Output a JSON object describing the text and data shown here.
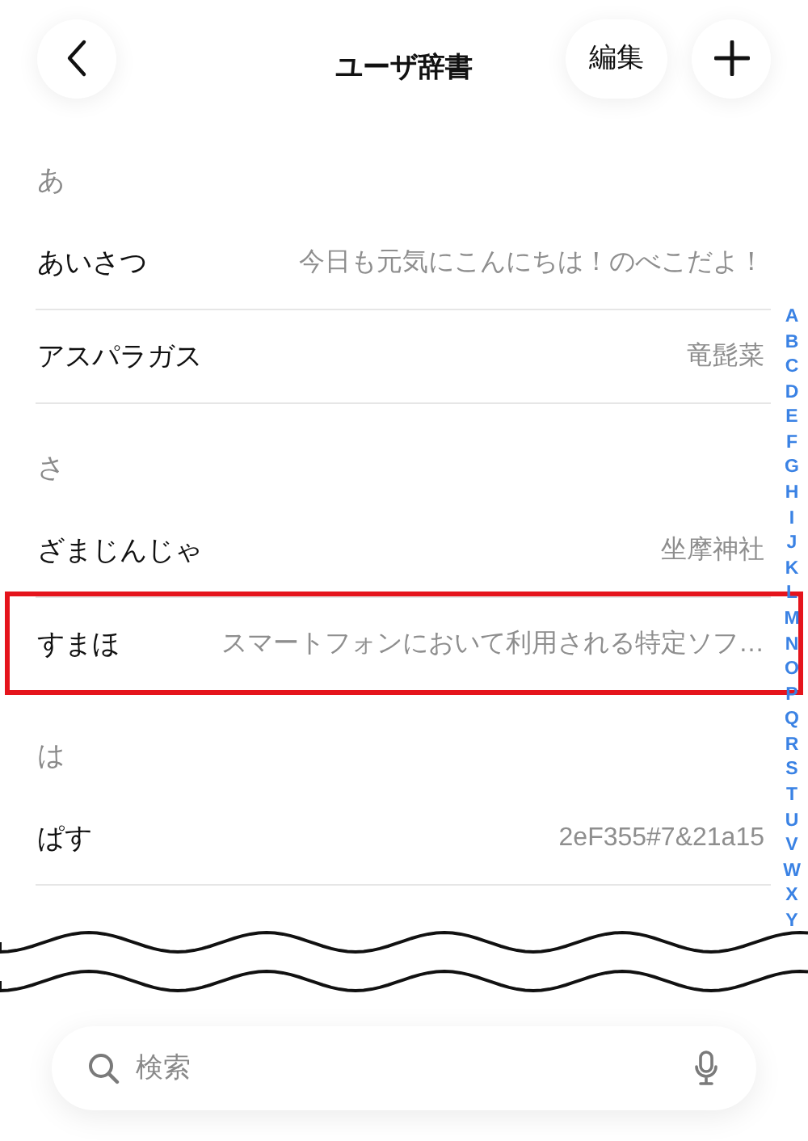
{
  "header": {
    "title": "ユーザ辞書",
    "edit_button": "編集"
  },
  "sections": [
    {
      "label": "あ",
      "entries": [
        {
          "reading": "あいさつ",
          "word": "今日も元気にこんにちは！のべこだよ！",
          "highlighted": false
        },
        {
          "reading": "アスパラガス",
          "word": "竜髭菜",
          "highlighted": false
        }
      ]
    },
    {
      "label": "さ",
      "entries": [
        {
          "reading": "ざまじんじゃ",
          "word": "坐摩神社",
          "highlighted": false
        },
        {
          "reading": "すまほ",
          "word": "スマートフォンにおいて利用される特定ソフ…",
          "highlighted": true
        }
      ]
    },
    {
      "label": "は",
      "entries": [
        {
          "reading": "ぱす",
          "word": "2eF355#7&21a15",
          "highlighted": false
        }
      ]
    }
  ],
  "index_letters": [
    "A",
    "B",
    "C",
    "D",
    "E",
    "F",
    "G",
    "H",
    "I",
    "J",
    "K",
    "L",
    "M",
    "N",
    "O",
    "P",
    "Q",
    "R",
    "S",
    "T",
    "U",
    "V",
    "W",
    "X",
    "Y"
  ],
  "search": {
    "placeholder": "検索"
  }
}
